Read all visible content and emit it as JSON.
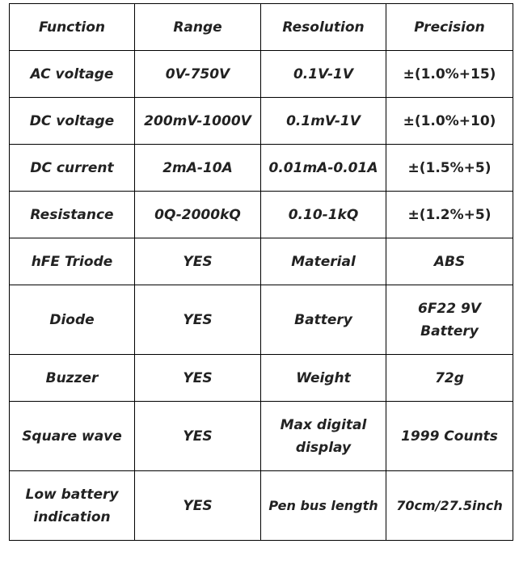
{
  "table": {
    "headers": [
      "Function",
      "Range",
      "Resolution",
      "Precision"
    ],
    "rows": [
      [
        "AC voltage",
        "0V-750V",
        "0.1V-1V",
        "±(1.0%+15)"
      ],
      [
        "DC voltage",
        "200mV-1000V",
        "0.1mV-1V",
        "±(1.0%+10)"
      ],
      [
        "DC current",
        "2mA-10A",
        "0.01mA-0.01A",
        "±(1.5%+5)"
      ],
      [
        "Resistance",
        "0Q-2000kQ",
        "0.10-1kQ",
        "±(1.2%+5)"
      ],
      [
        "hFE Triode",
        "YES",
        "Material",
        "ABS"
      ],
      [
        "Diode",
        "YES",
        "Battery",
        "6F22 9V Battery"
      ],
      [
        "Buzzer",
        "YES",
        "Weight",
        "72g"
      ],
      [
        "Square wave",
        "YES",
        "Max digital display",
        "1999 Counts"
      ],
      [
        "Low battery indication",
        "YES",
        "Pen bus length",
        "70cm/27.5inch"
      ]
    ]
  }
}
